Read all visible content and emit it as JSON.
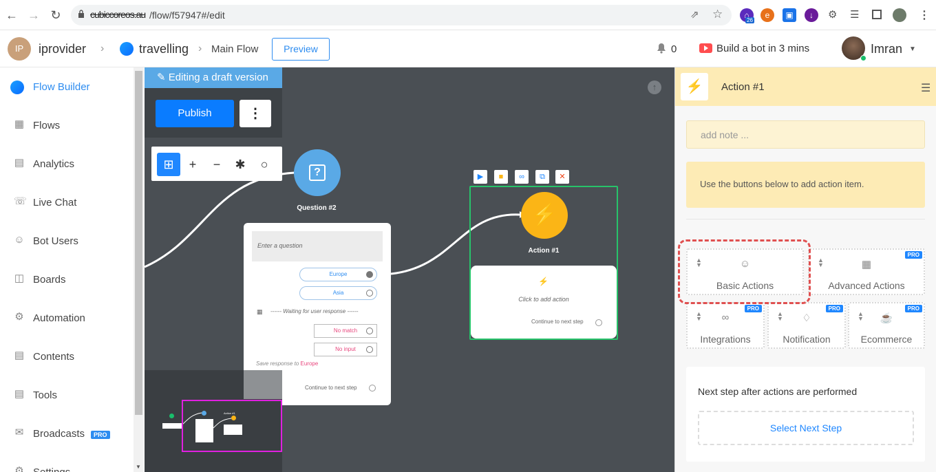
{
  "browser": {
    "url_host": "cubiccoreos.au",
    "url_path": "/flow/f57947#/edit",
    "ext_badge": "26"
  },
  "header": {
    "workspace_initials": "IP",
    "workspace_name": "iprovider",
    "bot_name": "travelling",
    "flow_name": "Main Flow",
    "preview_label": "Preview",
    "notifications_count": "0",
    "build_bot_label": "Build a bot in 3 mins",
    "user_name": "Imran"
  },
  "sidebar": {
    "items": [
      {
        "label": "Flow Builder",
        "icon": "messenger-icon",
        "active": true
      },
      {
        "label": "Flows",
        "icon": "grid-icon"
      },
      {
        "label": "Analytics",
        "icon": "chart-icon"
      },
      {
        "label": "Live Chat",
        "icon": "headset-icon"
      },
      {
        "label": "Bot Users",
        "icon": "user-icon"
      },
      {
        "label": "Boards",
        "icon": "board-icon"
      },
      {
        "label": "Automation",
        "icon": "automation-icon"
      },
      {
        "label": "Contents",
        "icon": "contents-icon"
      },
      {
        "label": "Tools",
        "icon": "tools-icon"
      },
      {
        "label": "Broadcasts",
        "icon": "megaphone-icon",
        "badge": "PRO"
      },
      {
        "label": "Settings",
        "icon": "settings-icon"
      }
    ]
  },
  "canvas": {
    "draft_banner": "Editing a draft version",
    "publish_label": "Publish",
    "question_title": "Question #2",
    "question_placeholder": "Enter a question",
    "options": [
      "Europe",
      "Asia"
    ],
    "waiting_text": "------ Waiting for user response ------",
    "no_match": "No match",
    "no_input": "No input",
    "save_response_prefix": "Save response to",
    "save_response_var": "Europe",
    "continue_text": "Continue to next step",
    "action_title": "Action #1",
    "click_to_add": "Click to add action",
    "minimap_label": "Action #1"
  },
  "panel": {
    "title": "Action #1",
    "note_placeholder": "add note ...",
    "hint": "Use the buttons below to add action item.",
    "action_types": [
      {
        "label": "Basic Actions",
        "icon": "user-icon",
        "pro": false
      },
      {
        "label": "Advanced Actions",
        "icon": "briefcase-icon",
        "pro": true
      },
      {
        "label": "Integrations",
        "icon": "link-icon",
        "pro": true
      },
      {
        "label": "Notification",
        "icon": "bell-icon",
        "pro": true
      },
      {
        "label": "Ecommerce",
        "icon": "cart-icon",
        "pro": true
      }
    ],
    "pro_badge": "PRO",
    "next_step_label": "Next step after actions are performed",
    "select_next_step": "Select Next Step"
  },
  "colors": {
    "accent": "#2d8cf0",
    "publish": "#0a7cff",
    "action_node": "#fbb516",
    "question_node": "#5aa9e6",
    "selected_border": "#27c36a",
    "highlight": "#e05050",
    "canvas_bg": "#4a4f54"
  }
}
